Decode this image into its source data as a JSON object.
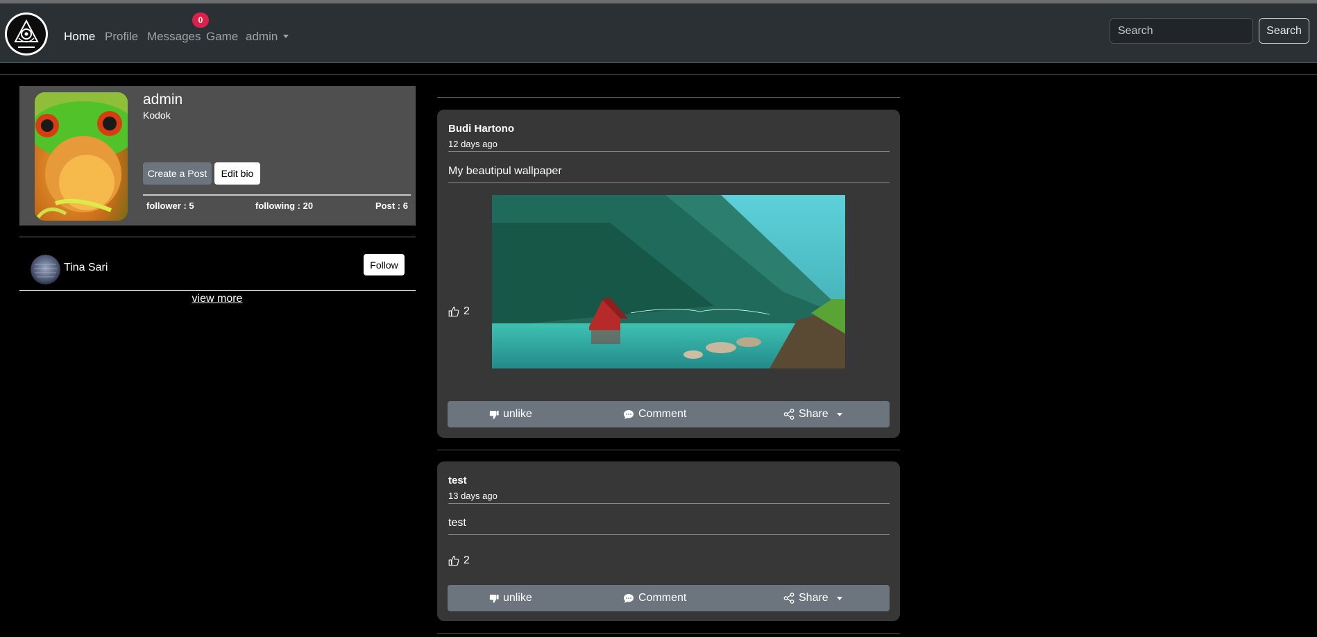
{
  "nav": {
    "logo_alt": "Kodok logo",
    "links": [
      {
        "label": "Home",
        "active": true
      },
      {
        "label": "Profile",
        "active": false
      },
      {
        "label": "Messages",
        "active": false
      },
      {
        "label": "Game",
        "active": false
      },
      {
        "label": "admin",
        "active": false
      }
    ],
    "messages_badge": "0",
    "search_placeholder": "Search",
    "search_button": "Search"
  },
  "profile": {
    "name": "admin",
    "bio": "Kodok",
    "create_post_label": "Create a Post",
    "edit_bio_label": "Edit bio",
    "follower": "follower : 5",
    "following": "following : 20",
    "posts": "Post : 6"
  },
  "suggestions": {
    "items": [
      {
        "name": "Tina Sari",
        "follow_label": "Follow"
      }
    ],
    "view_more": "view more"
  },
  "posts": [
    {
      "author": "Budi Hartono",
      "time": "12 days ago",
      "text": "My beautipul wallpaper",
      "likes": "2",
      "unlike_label": "unlike",
      "comment_label": "Comment",
      "share_label": "Share"
    },
    {
      "author": "test",
      "time": "13 days ago",
      "text": "test",
      "likes": "2",
      "unlike_label": "unlike",
      "comment_label": "Comment",
      "share_label": "Share"
    }
  ],
  "colors": {
    "navbar_bg": "#2b3035",
    "badge": "#dc1f4b",
    "profile_card_bg": "#4f4f4f",
    "post_bg": "#373737",
    "action_bar_bg": "#6c757d"
  }
}
